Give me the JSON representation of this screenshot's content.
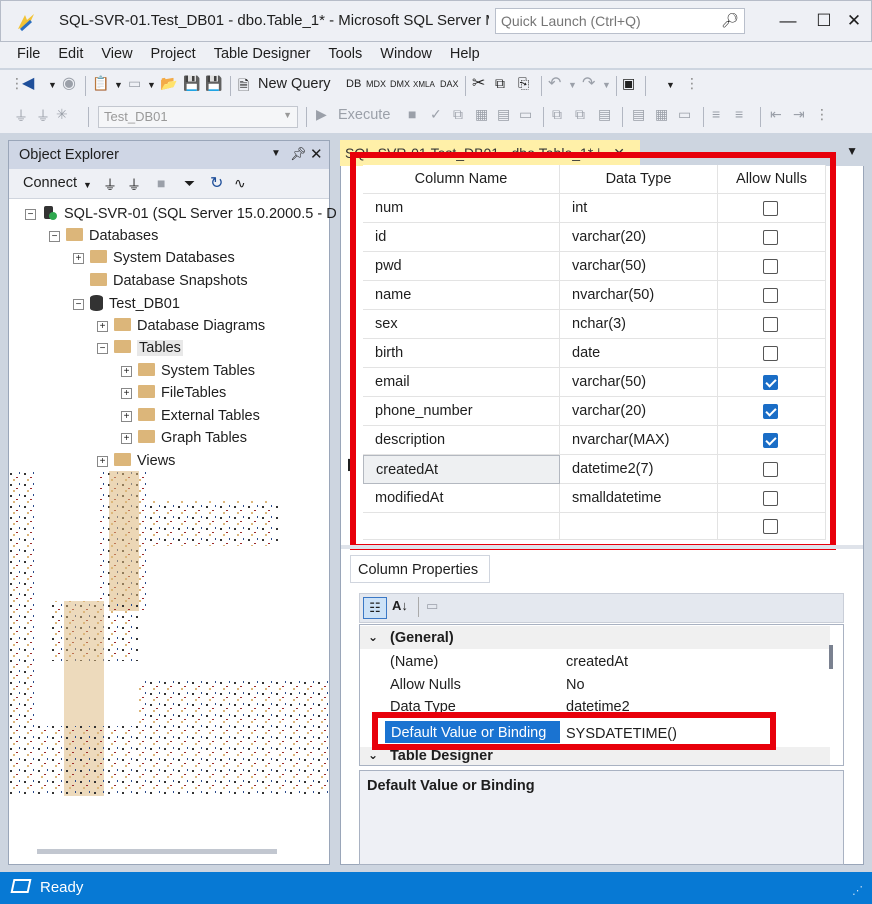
{
  "window": {
    "title": "SQL-SVR-01.Test_DB01 - dbo.Table_1* - Microsoft SQL Server M...",
    "quick_launch_placeholder": "Quick Launch (Ctrl+Q)",
    "minimize": "—",
    "maximize": "☐",
    "close": "✕"
  },
  "menu": [
    "File",
    "Edit",
    "View",
    "Project",
    "Table Designer",
    "Tools",
    "Window",
    "Help"
  ],
  "toolbar": {
    "new_query": "New Query",
    "execute": "Execute",
    "database_combo": "Test_DB01"
  },
  "object_explorer": {
    "title": "Object Explorer",
    "connect": "Connect",
    "server": "SQL-SVR-01 (SQL Server 15.0.2000.5 - D",
    "databases": "Databases",
    "system_databases": "System Databases",
    "database_snapshots": "Database Snapshots",
    "test_db": "Test_DB01",
    "database_diagrams": "Database Diagrams",
    "tables": "Tables",
    "system_tables": "System Tables",
    "file_tables": "FileTables",
    "external_tables": "External Tables",
    "graph_tables": "Graph Tables",
    "views": "Views"
  },
  "designer": {
    "tab_title": "SQL-SVR-01.Test_DB01 - dbo.Table_1*",
    "headers": {
      "column_name": "Column Name",
      "data_type": "Data Type",
      "allow_nulls": "Allow Nulls"
    },
    "rows": [
      {
        "name": "num",
        "type": "int",
        "nulls": false
      },
      {
        "name": "id",
        "type": "varchar(20)",
        "nulls": false
      },
      {
        "name": "pwd",
        "type": "varchar(50)",
        "nulls": false
      },
      {
        "name": "name",
        "type": "nvarchar(50)",
        "nulls": false
      },
      {
        "name": "sex",
        "type": "nchar(3)",
        "nulls": false
      },
      {
        "name": "birth",
        "type": "date",
        "nulls": false
      },
      {
        "name": "email",
        "type": "varchar(50)",
        "nulls": true
      },
      {
        "name": "phone_number",
        "type": "varchar(20)",
        "nulls": true
      },
      {
        "name": "description",
        "type": "nvarchar(MAX)",
        "nulls": true
      },
      {
        "name": "createdAt",
        "type": "datetime2(7)",
        "nulls": false
      },
      {
        "name": "modifiedAt",
        "type": "smalldatetime",
        "nulls": false
      },
      {
        "name": "",
        "type": "",
        "nulls": false
      }
    ]
  },
  "column_properties": {
    "tab_label": "Column Properties",
    "general": "(General)",
    "name_label": "(Name)",
    "name_value": "createdAt",
    "allow_nulls_label": "Allow Nulls",
    "allow_nulls_value": "No",
    "data_type_label": "Data Type",
    "data_type_value": "datetime2",
    "default_label": "Default Value or Binding",
    "default_value": "SYSDATETIME()",
    "table_designer": "Table Designer",
    "description_title": "Default Value or Binding"
  },
  "status": {
    "text": "Ready"
  },
  "colors": {
    "accent": "#0779d4",
    "highlight": "#e8000b",
    "selection": "#1a73d1",
    "folder": "#dcb67a"
  }
}
